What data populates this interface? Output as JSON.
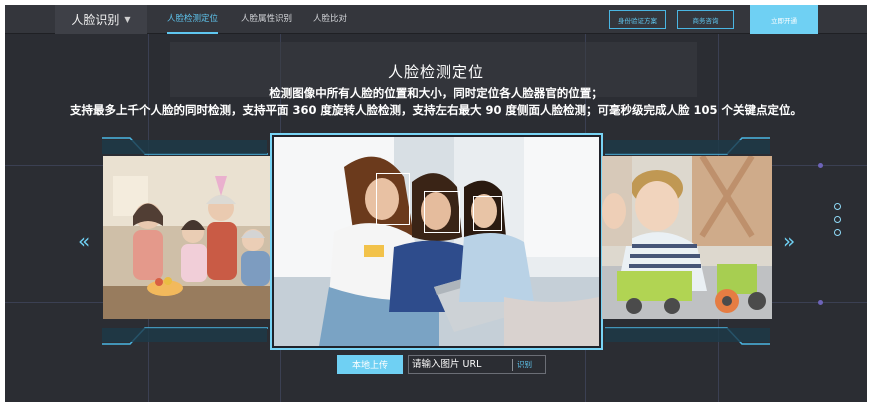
{
  "nav": {
    "brand": "人脸识别",
    "tabs": [
      {
        "label": "人脸检测定位",
        "active": true
      },
      {
        "label": "人脸属性识别",
        "active": false
      },
      {
        "label": "人脸比对",
        "active": false
      }
    ],
    "buttons": {
      "id_verify": "身份验证方案",
      "business": "商务咨询",
      "open_now": "立即开通"
    }
  },
  "hero": {
    "title": "人脸检测定位",
    "desc_line1": "检测图像中所有人脸的位置和大小，同时定位各人脸器官的位置；",
    "desc_line2": "支持最多上千个人脸的同时检测，支持平面 360 度旋转人脸检测，支持左右最大 90 度侧面人脸检测；可毫秒级完成人脸 105 个关键点定位。"
  },
  "carousel": {
    "prev_glyph": "«",
    "next_glyph": "»",
    "page_count": 3,
    "detected_faces": 3
  },
  "controls": {
    "upload_label": "本地上传",
    "url_placeholder": "请输入图片 URL",
    "detect_label": "识别"
  },
  "colors": {
    "accent": "#6fd0f3",
    "background": "#2b2d33",
    "topbar": "#34363c"
  }
}
